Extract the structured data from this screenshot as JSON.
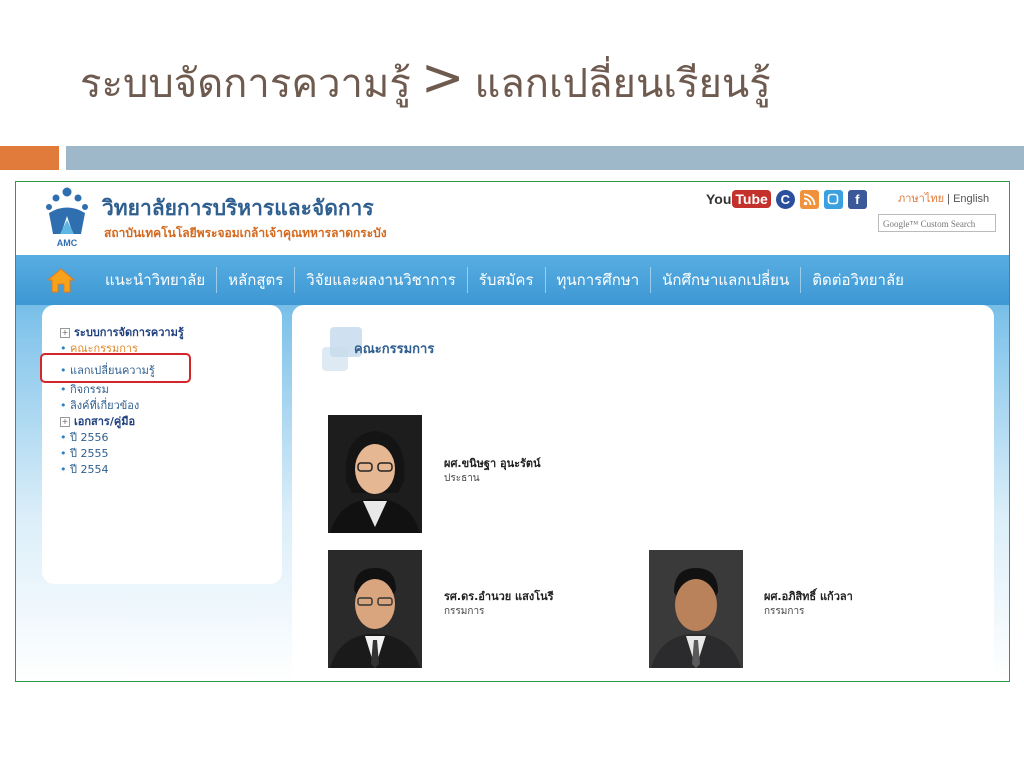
{
  "slide": {
    "title": "ระบบจัดการความรู้",
    "separator": ">",
    "subtitle": "แลกเปลี่ยนเรียนรู้"
  },
  "colors": {
    "title_text": "#6e5a4e",
    "bar_orange": "#e07b3c",
    "bar_blue": "#9fb8c9",
    "nav_blue": "#3d97d3",
    "highlight_red": "#d4252a"
  },
  "site": {
    "logo_text": "AMC",
    "name": "วิทยาลัยการบริหารและจัดการ",
    "subname": "สถาบันเทคโนโลยีพระจอมเกล้าเจ้าคุณทหารลาดกระบัง",
    "social": {
      "youtube_you": "You",
      "youtube_tube": "Tube",
      "icons": [
        "youtube-icon",
        "circle-logo-icon",
        "rss-icon",
        "blogger-icon",
        "facebook-icon"
      ]
    },
    "lang_thai": "ภาษาไทย",
    "lang_sep": "|",
    "lang_english": "English",
    "search_placeholder": "Google™ Custom Search"
  },
  "nav": {
    "items": [
      "แนะนำวิทยาลัย",
      "หลักสูตร",
      "วิจัยและผลงานวิชาการ",
      "รับสมัคร",
      "ทุนการศึกษา",
      "นักศึกษาแลกเปลี่ยน",
      "ติดต่อวิทยาลัย"
    ]
  },
  "sidebar": {
    "km_heading": "ระบบการจัดการความรู้",
    "km_items": [
      "คณะกรรมการ",
      "แลกเปลี่ยนความรู้",
      "กิจกรรม",
      "ลิงค์ที่เกี่ยวข้อง"
    ],
    "docs_heading": "เอกสาร/คู่มือ",
    "docs_items": [
      "ปี 2556",
      "ปี 2555",
      "ปี 2554"
    ]
  },
  "main": {
    "heading": "คณะกรรมการ",
    "people": [
      {
        "name": "ผศ.ขนิษฐา อุนะรัตน์",
        "role": "ประธาน"
      },
      {
        "name": "รศ.ดร.อำนวย แสงโนรี",
        "role": "กรรมการ"
      },
      {
        "name": "ผศ.อภิสิทธิ์ แก้วลา",
        "role": "กรรมการ"
      }
    ]
  }
}
